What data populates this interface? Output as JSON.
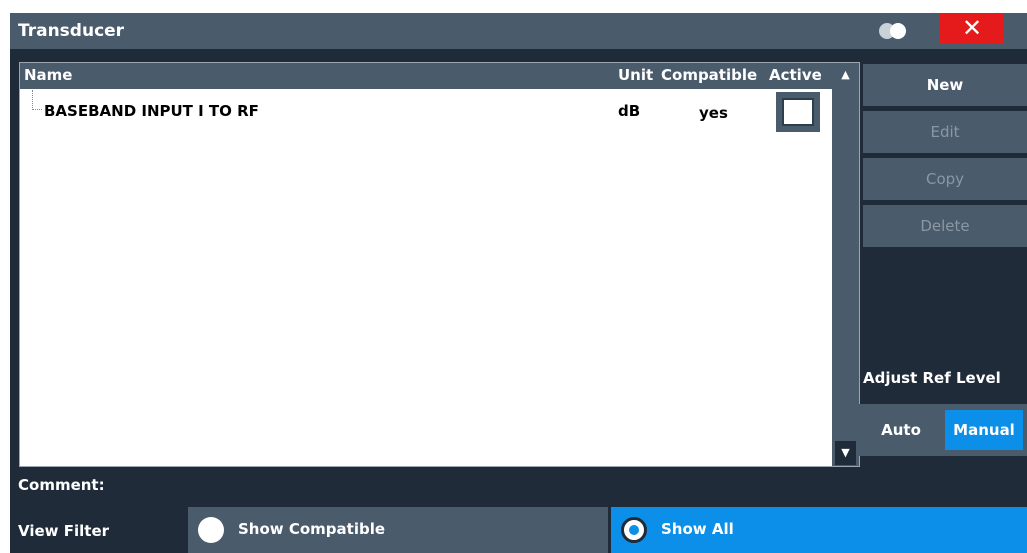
{
  "dialog": {
    "title": "Transducer",
    "close_label": "✕"
  },
  "table": {
    "columns": {
      "name": "Name",
      "unit": "Unit",
      "compatible": "Compatible",
      "active": "Active"
    },
    "rows": [
      {
        "name": "BASEBAND INPUT I TO RF",
        "unit": "dB",
        "compatible": "yes",
        "active": false
      }
    ],
    "scroll_up": "▲",
    "scroll_down": "▼"
  },
  "side_buttons": {
    "new": "New",
    "edit": "Edit",
    "copy": "Copy",
    "delete": "Delete"
  },
  "adjust_ref_level": {
    "label": "Adjust Ref Level",
    "auto": "Auto",
    "manual": "Manual",
    "selected": "Manual"
  },
  "comment": {
    "label": "Comment:"
  },
  "view_filter": {
    "label": "View Filter",
    "options": [
      "Show Compatible",
      "Show All"
    ],
    "selected": "Show All"
  },
  "colors": {
    "background": "#1f2b38",
    "panel": "#4a5b6c",
    "accent": "#0c8fe8",
    "close": "#e51a1a"
  }
}
